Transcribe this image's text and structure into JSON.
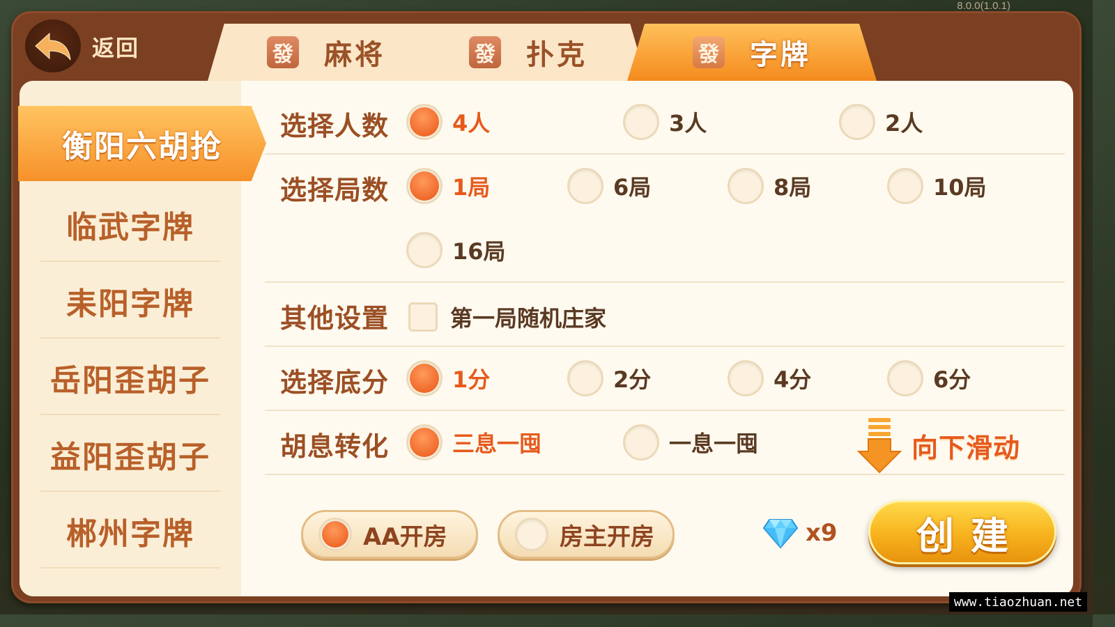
{
  "version": "8.0.0(1.0.1)",
  "header": {
    "back_label": "返回",
    "tabs": [
      {
        "icon_char": "發",
        "label": "麻将",
        "active": false
      },
      {
        "icon_char": "發",
        "label": "扑克",
        "active": false
      },
      {
        "icon_char": "發",
        "label": "字牌",
        "active": true
      }
    ]
  },
  "sidebar": {
    "items": [
      {
        "label": "衡阳六胡抢",
        "active": true
      },
      {
        "label": "临武字牌",
        "active": false
      },
      {
        "label": "耒阳字牌",
        "active": false
      },
      {
        "label": "岳阳歪胡子",
        "active": false
      },
      {
        "label": "益阳歪胡子",
        "active": false
      },
      {
        "label": "郴州字牌",
        "active": false
      }
    ]
  },
  "settings": {
    "players": {
      "label": "选择人数",
      "options": [
        "4人",
        "3人",
        "2人"
      ],
      "selected": "4人"
    },
    "rounds": {
      "label": "选择局数",
      "options": [
        "1局",
        "6局",
        "8局",
        "10局",
        "16局"
      ],
      "selected": "1局"
    },
    "other": {
      "label": "其他设置",
      "checkbox_label": "第一局随机庄家",
      "checked": false
    },
    "base_score": {
      "label": "选择底分",
      "options": [
        "1分",
        "2分",
        "4分",
        "6分"
      ],
      "selected": "1分"
    },
    "conversion": {
      "label": "胡息转化",
      "options": [
        "三息一囤",
        "一息一囤"
      ],
      "selected": "三息一囤"
    }
  },
  "scroll_hint": "向下滑动",
  "payment": {
    "options": [
      {
        "label": "AA开房",
        "selected": true
      },
      {
        "label": "房主开房",
        "selected": false
      }
    ]
  },
  "cost": {
    "icon": "diamond-icon",
    "count": "x9"
  },
  "create_label": "创建",
  "watermark": "www.tiaozhuan.net",
  "colors": {
    "accent_orange": "#f48b1e",
    "label_brown": "#9b4f24",
    "selected_red": "#e65a1c",
    "frame": "#7b3f22"
  }
}
